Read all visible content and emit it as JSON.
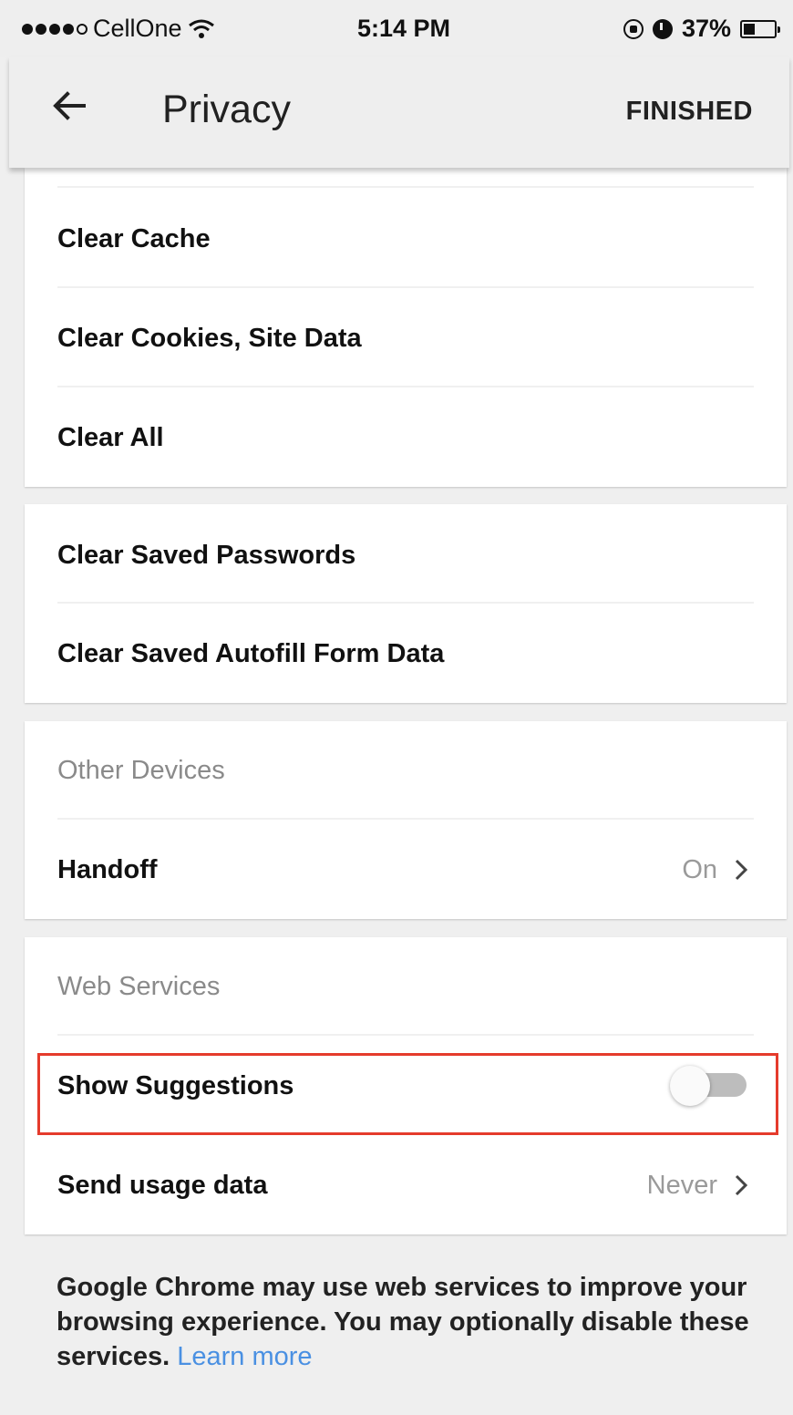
{
  "status_bar": {
    "carrier": "CellOne",
    "time": "5:14 PM",
    "battery": "37%",
    "battery_level": 0.37,
    "signal_bars": 4,
    "signal_total": 5
  },
  "app_bar": {
    "title": "Privacy",
    "action_label": "FINISHED",
    "icons": [
      "back-arrow-icon"
    ]
  },
  "card_clear": {
    "items": [
      {
        "label": "Clear Cache"
      },
      {
        "label": "Clear Cookies, Site Data"
      },
      {
        "label": "Clear All"
      }
    ]
  },
  "card_saved": {
    "items": [
      {
        "label": "Clear Saved Passwords"
      },
      {
        "label": "Clear Saved Autofill Form Data"
      }
    ]
  },
  "card_other_devices": {
    "header": "Other Devices",
    "handoff": {
      "label": "Handoff",
      "value": "On"
    }
  },
  "card_web_services": {
    "header": "Web Services",
    "show_suggestions": {
      "label": "Show Suggestions",
      "enabled": false
    },
    "send_usage": {
      "label": "Send usage data",
      "value": "Never"
    }
  },
  "footer": {
    "text": "Google Chrome may use web services to improve your browsing experience. You may optionally disable these services.",
    "link": "Learn more"
  },
  "colors": {
    "link": "#4a90e2",
    "highlight": "#e53b2c",
    "toggle_track_off": "#bdbdbd"
  }
}
